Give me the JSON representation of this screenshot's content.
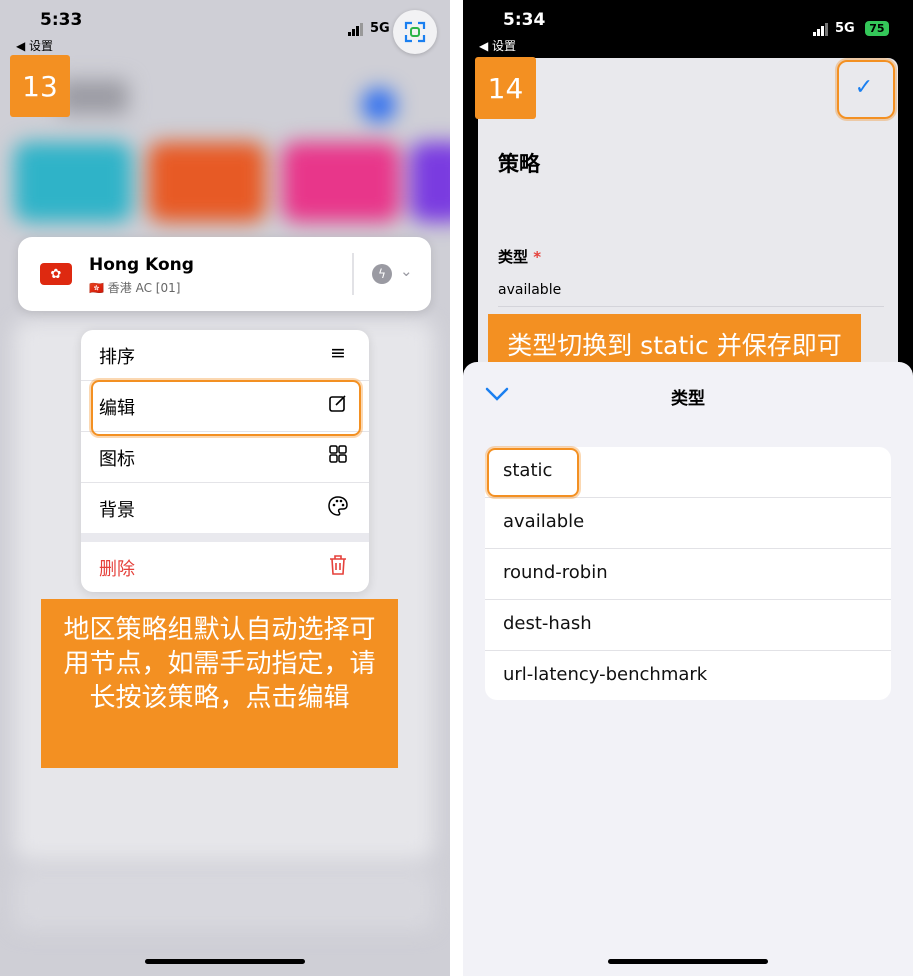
{
  "left": {
    "status": {
      "time": "5:33",
      "back": "◀ 设置",
      "network": "5G"
    },
    "step": "13",
    "scan_icon": "scan-qr-icon",
    "proxy_card": {
      "name": "Hong Kong",
      "subtitle": "🇭🇰 香港 AC [01]",
      "flag": "🇭🇰"
    },
    "menu": {
      "items": [
        {
          "label": "排序",
          "icon": "≡"
        },
        {
          "label": "编辑",
          "icon": "✎"
        },
        {
          "label": "图标",
          "icon": "⊞"
        },
        {
          "label": "背景",
          "icon": "🎨"
        }
      ],
      "delete_label": "删除",
      "delete_icon": "🗑"
    },
    "callout": "地区策略组默认自动选择可用节点，如需手动指定，请长按该策略，点击编辑"
  },
  "right": {
    "status": {
      "time": "5:34",
      "back": "◀ 设置",
      "network": "5G",
      "battery": "75"
    },
    "step": "14",
    "confirm_icon": "✓",
    "title": "策略",
    "type_label": "类型",
    "required_mark": "*",
    "type_value": "available",
    "callout": "类型切换到 static 并保存即可",
    "sheet": {
      "title": "类型",
      "options": [
        "static",
        "available",
        "round-robin",
        "dest-hash",
        "url-latency-benchmark"
      ]
    }
  },
  "colors": {
    "accent_orange": "#f39022",
    "delete_red": "#e5403a",
    "ios_blue": "#1a7ff0"
  }
}
